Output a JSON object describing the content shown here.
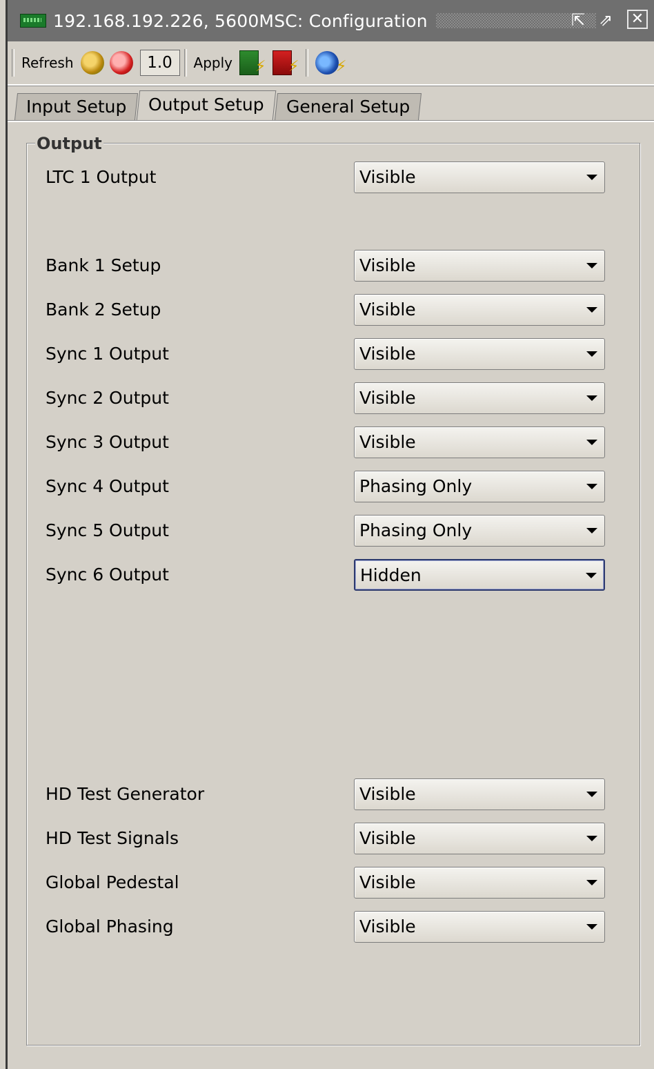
{
  "window": {
    "title": "192.168.192.226, 5600MSC: Configuration",
    "detach_glyph": "⇱",
    "maximize_glyph": "⇗",
    "close_glyph": "✕"
  },
  "toolbar": {
    "refresh_label": "Refresh",
    "version_value": "1.0",
    "apply_label": "Apply"
  },
  "tabs": [
    {
      "label": "Input Setup",
      "active": false
    },
    {
      "label": "Output Setup",
      "active": true
    },
    {
      "label": "General Setup",
      "active": false
    }
  ],
  "group": {
    "title": "Output",
    "rows": [
      {
        "label": "LTC 1 Output",
        "value": "Visible"
      },
      {
        "label": "Bank 1 Setup",
        "value": "Visible"
      },
      {
        "label": "Bank 2 Setup",
        "value": "Visible"
      },
      {
        "label": "Sync 1 Output",
        "value": "Visible"
      },
      {
        "label": "Sync 2 Output",
        "value": "Visible"
      },
      {
        "label": "Sync 3 Output",
        "value": "Visible"
      },
      {
        "label": "Sync 4 Output",
        "value": "Phasing Only"
      },
      {
        "label": "Sync 5 Output",
        "value": "Phasing Only"
      },
      {
        "label": "Sync 6 Output",
        "value": "Hidden",
        "focused": true
      },
      {
        "label": "HD Test Generator",
        "value": "Visible"
      },
      {
        "label": "HD Test Signals",
        "value": "Visible"
      },
      {
        "label": "Global Pedestal",
        "value": "Visible"
      },
      {
        "label": "Global Phasing",
        "value": "Visible"
      }
    ]
  },
  "icons": {
    "title": "device-card-icon",
    "refresh": "refresh-icon",
    "refresh_all": "refresh-all-icon",
    "apply": "apply-icon",
    "apply_all": "apply-all-icon",
    "apply_network": "apply-network-icon"
  }
}
